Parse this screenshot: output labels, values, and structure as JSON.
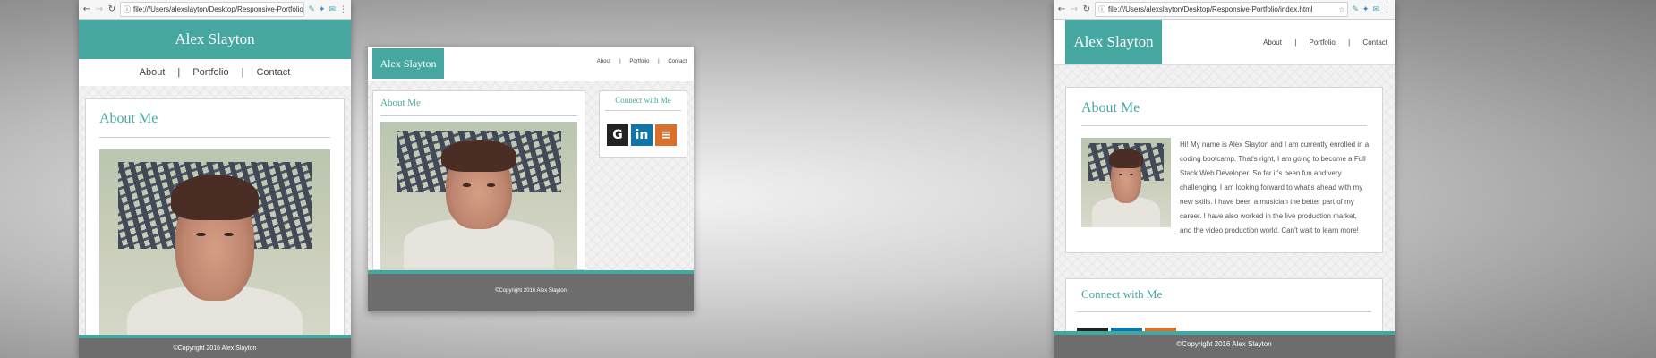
{
  "site": {
    "name": "Alex Slayton",
    "nav": [
      "About",
      "Portfolio",
      "Contact"
    ],
    "separator": "|",
    "about_heading": "About Me",
    "connect_heading": "Connect with Me",
    "bio": "Hi! My name is Alex Slayton and I am currently enrolled in a coding bootcamp. That's right, I am going to become a Full Stack Web Developer. So far it's been fun and very challenging. I am looking forward to what's ahead with my new skills. I have been a musician the better part of my career. I have also worked in the live production market, and the video production world. Can't wait to learn more!",
    "copyright": "©Copyright 2016 Alex Slayton",
    "social": [
      {
        "name": "GitHub",
        "icon": "github-icon",
        "glyph": "G",
        "color": "#232323"
      },
      {
        "name": "LinkedIn",
        "icon": "linkedin-icon",
        "glyph": "in",
        "color": "#0e76a8"
      },
      {
        "name": "Stack Overflow",
        "icon": "stackoverflow-icon",
        "glyph": "≡",
        "color": "#d9702b"
      }
    ],
    "accent": "#46a6a0",
    "footer_bg": "#6d6d6d"
  },
  "browser_left": {
    "url": "file:///Users/alexslayton/Desktop/Responsive-Portfolio/i..."
  },
  "browser_right": {
    "url": "file:///Users/alexslayton/Desktop/Responsive-Portfolio/index.html"
  },
  "icons": {
    "back": "←",
    "forward": "→",
    "reload": "↻",
    "info": "ⓘ",
    "star": "☆",
    "menu": "⋮"
  }
}
